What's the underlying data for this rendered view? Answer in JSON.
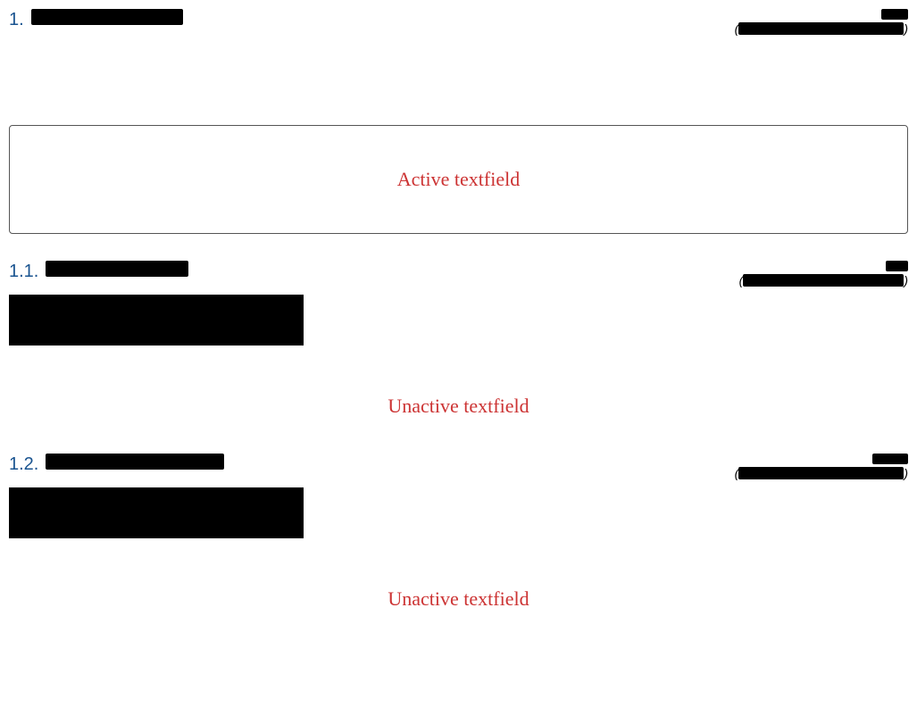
{
  "sections": [
    {
      "number": "1.",
      "active_label": "Active textfield"
    },
    {
      "number": "1.1.",
      "unactive_label": "Unactive textfield"
    },
    {
      "number": "1.2.",
      "unactive_label": "Unactive textfield"
    }
  ]
}
